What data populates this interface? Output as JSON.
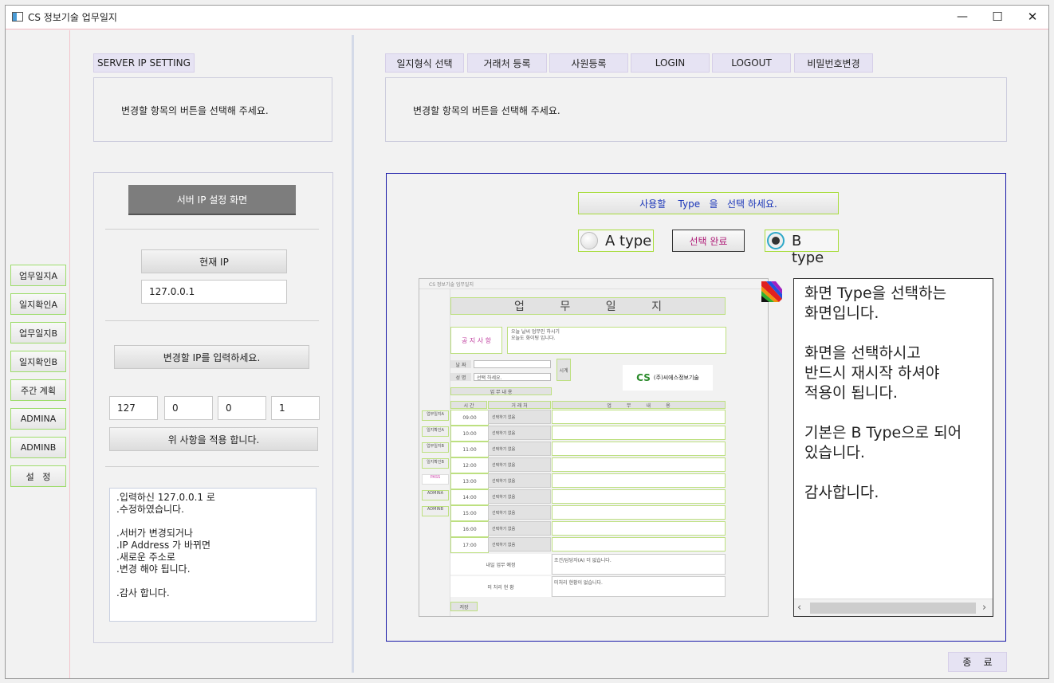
{
  "window": {
    "title": "CS 정보기술 업무일지",
    "controls": [
      "—",
      "☐",
      "✕"
    ]
  },
  "left_nav": [
    "업무일지A",
    "일지확인A",
    "업무일지B",
    "일지확인B",
    "주간 계획",
    "ADMINA",
    "ADMINB",
    "설   정"
  ],
  "server_panel": {
    "tab": "SERVER IP SETTING",
    "message": "변경할 항목의 버튼을 선택해 주세요.",
    "screen_title": "서버 IP 설정 화면",
    "current_ip_label": "현재  IP",
    "current_ip_value": "127.0.0.1",
    "enter_ip_label": "변경할 IP를 입력하세요.",
    "ip_parts": [
      "127",
      "0",
      "0",
      "1"
    ],
    "apply_label": "위 사항을 적용 합니다.",
    "notes": [
      ".입력하신 127.0.0.1 로",
      ".수정하였습니다.",
      "",
      ".서버가 변경되거나",
      ".IP Address 가 바뀌면",
      ".새로운 주소로",
      ".변경 해야 됩니다.",
      "",
      ".감사 합니다."
    ]
  },
  "top_tabs": [
    "일지형식 선택",
    "거래처 등록",
    "사원등록",
    "LOGIN",
    "LOGOUT",
    "비밀번호변경"
  ],
  "right_message": "변경할 항목의 버튼을 선택해 주세요.",
  "type_select": {
    "header": "사용할    Type   을   선택 하세요.",
    "option_a": "A type",
    "option_b": "B type",
    "confirm": "선택 완료",
    "selected": "B"
  },
  "preview": {
    "title": "CS 정보기술 업무일지",
    "heading": "업          무          일          지",
    "notice_label": "공 지 사 항",
    "notice_text": [
      "오늘 날씨 업무인 하시기",
      "오늘도 화이팅 입니다."
    ],
    "name_label": "성  명",
    "name_select": "선택 하세요.",
    "date_label": "날  짜",
    "btn_label": "시계",
    "logo_text": "(주)씨에스정보기술",
    "plan_label": "업 무 내 용",
    "col_time": "시  간",
    "col_client": "거 래 처",
    "col_content": "업          무          내          용",
    "times": [
      "09:00",
      "10:00",
      "11:00",
      "12:00",
      "13:00",
      "14:00",
      "15:00",
      "16:00",
      "17:00"
    ],
    "client_select": "선택하기 없음",
    "side_items": [
      "업무일지A",
      "일지확인A",
      "업무일지B",
      "일지확인B",
      "PASS",
      "ADMINA",
      "ADMINB"
    ],
    "tomorrow_label": "내일 업무 예정",
    "tomorrow_text": "조건/담당자(A) 더 없습니다.",
    "other_label": "미 처리  현 황",
    "other_text": "미처리 현황이 없습니다.",
    "save_label": "저장"
  },
  "info_text": [
    "화면 Type을 선택하는",
    "화면입니다.",
    "",
    "화면을 선택하시고",
    "반드시 재시작 하셔야",
    "적용이 됩니다.",
    "",
    "기본은 B Type으로 되어",
    "있습니다.",
    "",
    "감사합니다."
  ],
  "exit_label": "종    료"
}
